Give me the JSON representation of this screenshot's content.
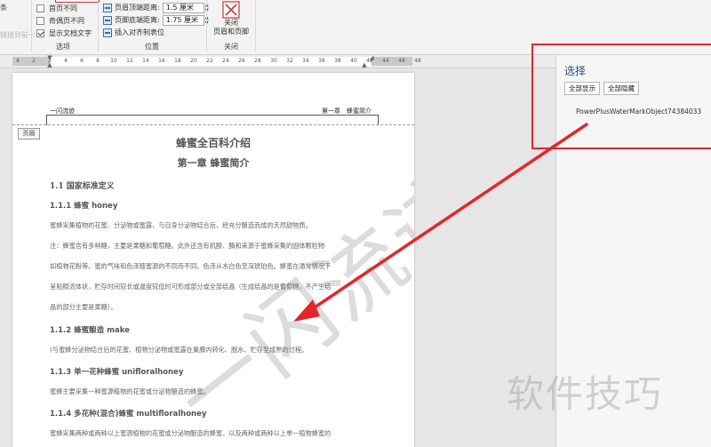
{
  "ribbon": {
    "left_stubs": [
      "条",
      "",
      "链接到前一节"
    ],
    "options": {
      "items": [
        {
          "label": "首页不同",
          "checked": false
        },
        {
          "label": "奇偶页不同",
          "checked": false
        },
        {
          "label": "显示文档文字",
          "checked": true
        }
      ],
      "group_label": "选项"
    },
    "position": {
      "header_label": "页眉顶端距离:",
      "header_value": "1.5 厘米",
      "footer_label": "页脚底端距离:",
      "footer_value": "1.75 厘米",
      "align_tab_label": "插入对齐制表位",
      "group_label": "位置"
    },
    "close": {
      "label_line1": "关闭",
      "label_line2": "页眉和页脚",
      "group_label": "关闭"
    }
  },
  "ruler": {
    "ticks": [
      "4",
      "2",
      "2",
      "4",
      "6",
      "8",
      "10",
      "12",
      "14",
      "16",
      "18",
      "20",
      "22",
      "24",
      "26",
      "28",
      "30",
      "32",
      "34",
      "36",
      "38",
      "40",
      "42",
      "44",
      "46",
      "48"
    ]
  },
  "document": {
    "header_left": "一闪流迹",
    "header_right": "第一章　蜂蜜简介",
    "header_tag": "页眉",
    "title": "蜂蜜全百科介绍",
    "chapter": "第一章 蜂蜜简介",
    "section": "1.1 国家标准定义",
    "s111": "1.1.1 蜂蜜 honey",
    "p1": "蜜蜂采集植物的花蜜、分泌物或蜜露，与自身分泌物结合后，经充分酿造而成的天然甜物质。",
    "p2_1": "注：蜂蜜含有多种糖，主要是果糖和葡萄糖。此外还含有机酸、酶和来源于蜜蜂采集的固体颗粒物",
    "p2_2": "如植物花粉等。蜜的气味和色泽随蜜源的不同而不同。色泽从水白色至深琥珀色。蜂蜜在通常情况下",
    "p2_3": "呈粘稠流体状，贮存时间较长或温度较低时可形成部分或全部结晶（生成结晶的是葡萄糖，不产生结",
    "p2_4": "晶的部分主要是果糖）。",
    "s112": "1.1.2 蜂蜜酿造 make",
    "p3": "(与蜜蜂分泌物结合后的花蜜、植物分泌物或蜜露在巢脾内转化、脱水、贮存至成熟的过程。",
    "s113": "1.1.3 单一花种蜂蜜 unifloralhoney",
    "p4": "蜜蜂主要采集一种蜜源植物的花蜜或分泌物酿造的蜂蜜。",
    "s114": "1.1.4 多花种(混合)蜂蜜 multifloralhoney",
    "p5": "蜜蜂采集两种或两种以上蜜源植物的花蜜或分泌物酿造的蜂蜜，以及两种或两种以上单一植物蜂蜜的",
    "watermark": "一闪流迹"
  },
  "selection_pane": {
    "title": "选择",
    "show_all": "全部显示",
    "hide_all": "全部隐藏",
    "item": "PowerPlusWaterMarkObject74384033"
  },
  "brand_watermark": "软件技巧",
  "colors": {
    "highlight_red": "#e2262c",
    "pane_title": "#2a4d7a"
  }
}
